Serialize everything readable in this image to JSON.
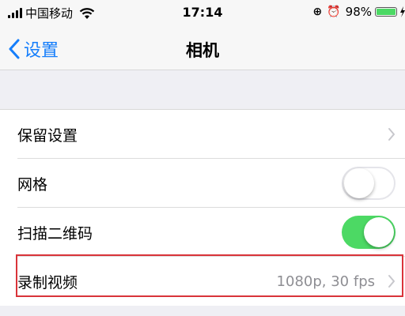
{
  "status_bar": {
    "carrier": "中国移动",
    "time": "17:14",
    "icons": [
      "signal-icon",
      "wifi-icon",
      "orientation-lock-icon",
      "alarm-icon",
      "battery-icon",
      "charging-icon"
    ],
    "orientation_lock_glyph": "⊕",
    "alarm_glyph": "⏰",
    "battery_percent": "98%",
    "battery_level": 0.98,
    "battery_color": "#4cd964"
  },
  "nav": {
    "back_label": "设置",
    "title": "相机",
    "accent_color": "#157efb"
  },
  "settings": {
    "rows": [
      {
        "label": "保留设置",
        "control": "disclosure"
      },
      {
        "label": "网格",
        "control": "toggle",
        "on": false
      },
      {
        "label": "扫描二维码",
        "control": "toggle",
        "on": true
      },
      {
        "label": "录制视频",
        "control": "disclosure",
        "value": "1080p, 30 fps",
        "highlighted": true
      }
    ]
  }
}
